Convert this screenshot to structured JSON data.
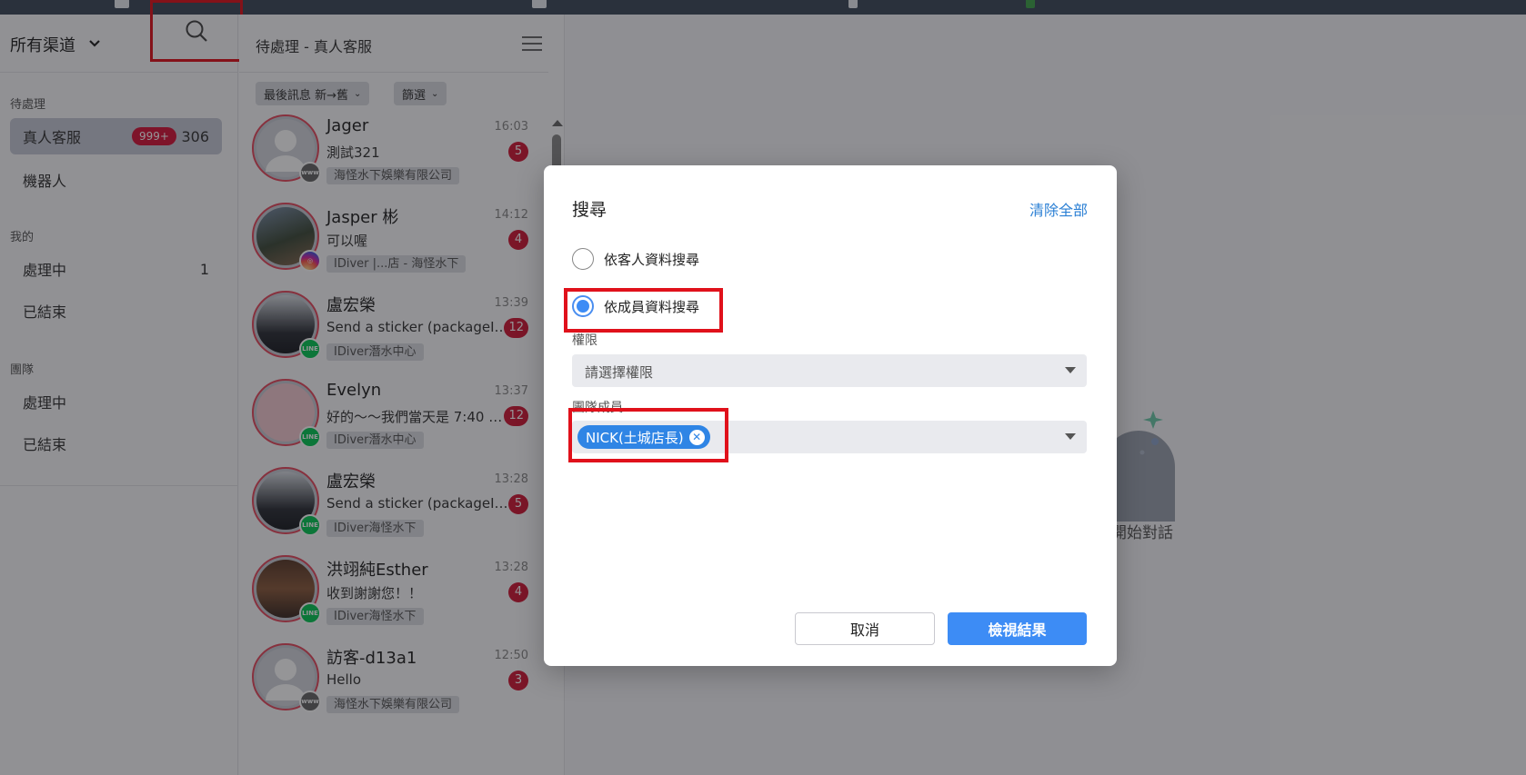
{
  "sidebar": {
    "channel_title": "所有渠道",
    "sections": {
      "pending": "待處理",
      "mine": "我的",
      "team": "團隊"
    },
    "items": {
      "human": {
        "label": "真人客服",
        "badge": "999+",
        "count": "306"
      },
      "bot": {
        "label": "機器人"
      },
      "my_processing": {
        "label": "處理中",
        "count": "1"
      },
      "my_closed": {
        "label": "已結束"
      },
      "team_processing": {
        "label": "處理中"
      },
      "team_closed": {
        "label": "已結束"
      }
    }
  },
  "list": {
    "title": "待處理 - 真人客服",
    "sort_label": "最後訊息 新→舊",
    "filter_label": "篩選",
    "conversations": [
      {
        "name": "Jager",
        "time": "16:03",
        "message": "測試321",
        "unread": "5",
        "tag": "海怪水下娛樂有限公司",
        "channel": "www"
      },
      {
        "name": "Jasper 彬",
        "time": "14:12",
        "message": "可以喔",
        "unread": "4",
        "tag": "IDiver |...店 - 海怪水下",
        "channel": "instagram"
      },
      {
        "name": "盧宏榮",
        "time": "13:39",
        "message": "Send a sticker (packageI…",
        "unread": "12",
        "tag": "IDiver潛水中心",
        "channel": "line"
      },
      {
        "name": "Evelyn",
        "time": "13:37",
        "message": "好的～～我們當天是 7:40 …",
        "unread": "12",
        "tag": "IDiver潛水中心",
        "channel": "line"
      },
      {
        "name": "盧宏榮",
        "time": "13:28",
        "message": "Send a sticker (packageId…",
        "unread": "5",
        "tag": "IDiver海怪水下",
        "channel": "line"
      },
      {
        "name": "洪翊純Esther",
        "time": "13:28",
        "message": "收到謝謝您！！",
        "unread": "4",
        "tag": "IDiver海怪水下",
        "channel": "line"
      },
      {
        "name": "訪客-d13a1",
        "time": "12:50",
        "message": "Hello",
        "unread": "3",
        "tag": "海怪水下娛樂有限公司",
        "channel": "www"
      }
    ]
  },
  "main": {
    "empty_text": "開始對話"
  },
  "modal": {
    "title": "搜尋",
    "clear_all": "清除全部",
    "radio_customer": "依客人資料搜尋",
    "radio_member": "依成員資料搜尋",
    "selected_radio": "member",
    "permission_label": "權限",
    "permission_placeholder": "請選擇權限",
    "team_member_label": "團隊成員",
    "selected_member": "NICK(土城店長)",
    "cancel": "取消",
    "view_results": "檢視結果"
  },
  "colors": {
    "accent": "#3d8cf5",
    "unread_badge": "#cf1836",
    "highlight_box": "#e0111b",
    "line_green": "#06c755"
  },
  "icons": {
    "search": "search-icon",
    "menu": "hamburger-menu-icon",
    "chevron": "chevron-down-icon",
    "remove": "close-circle-icon"
  }
}
